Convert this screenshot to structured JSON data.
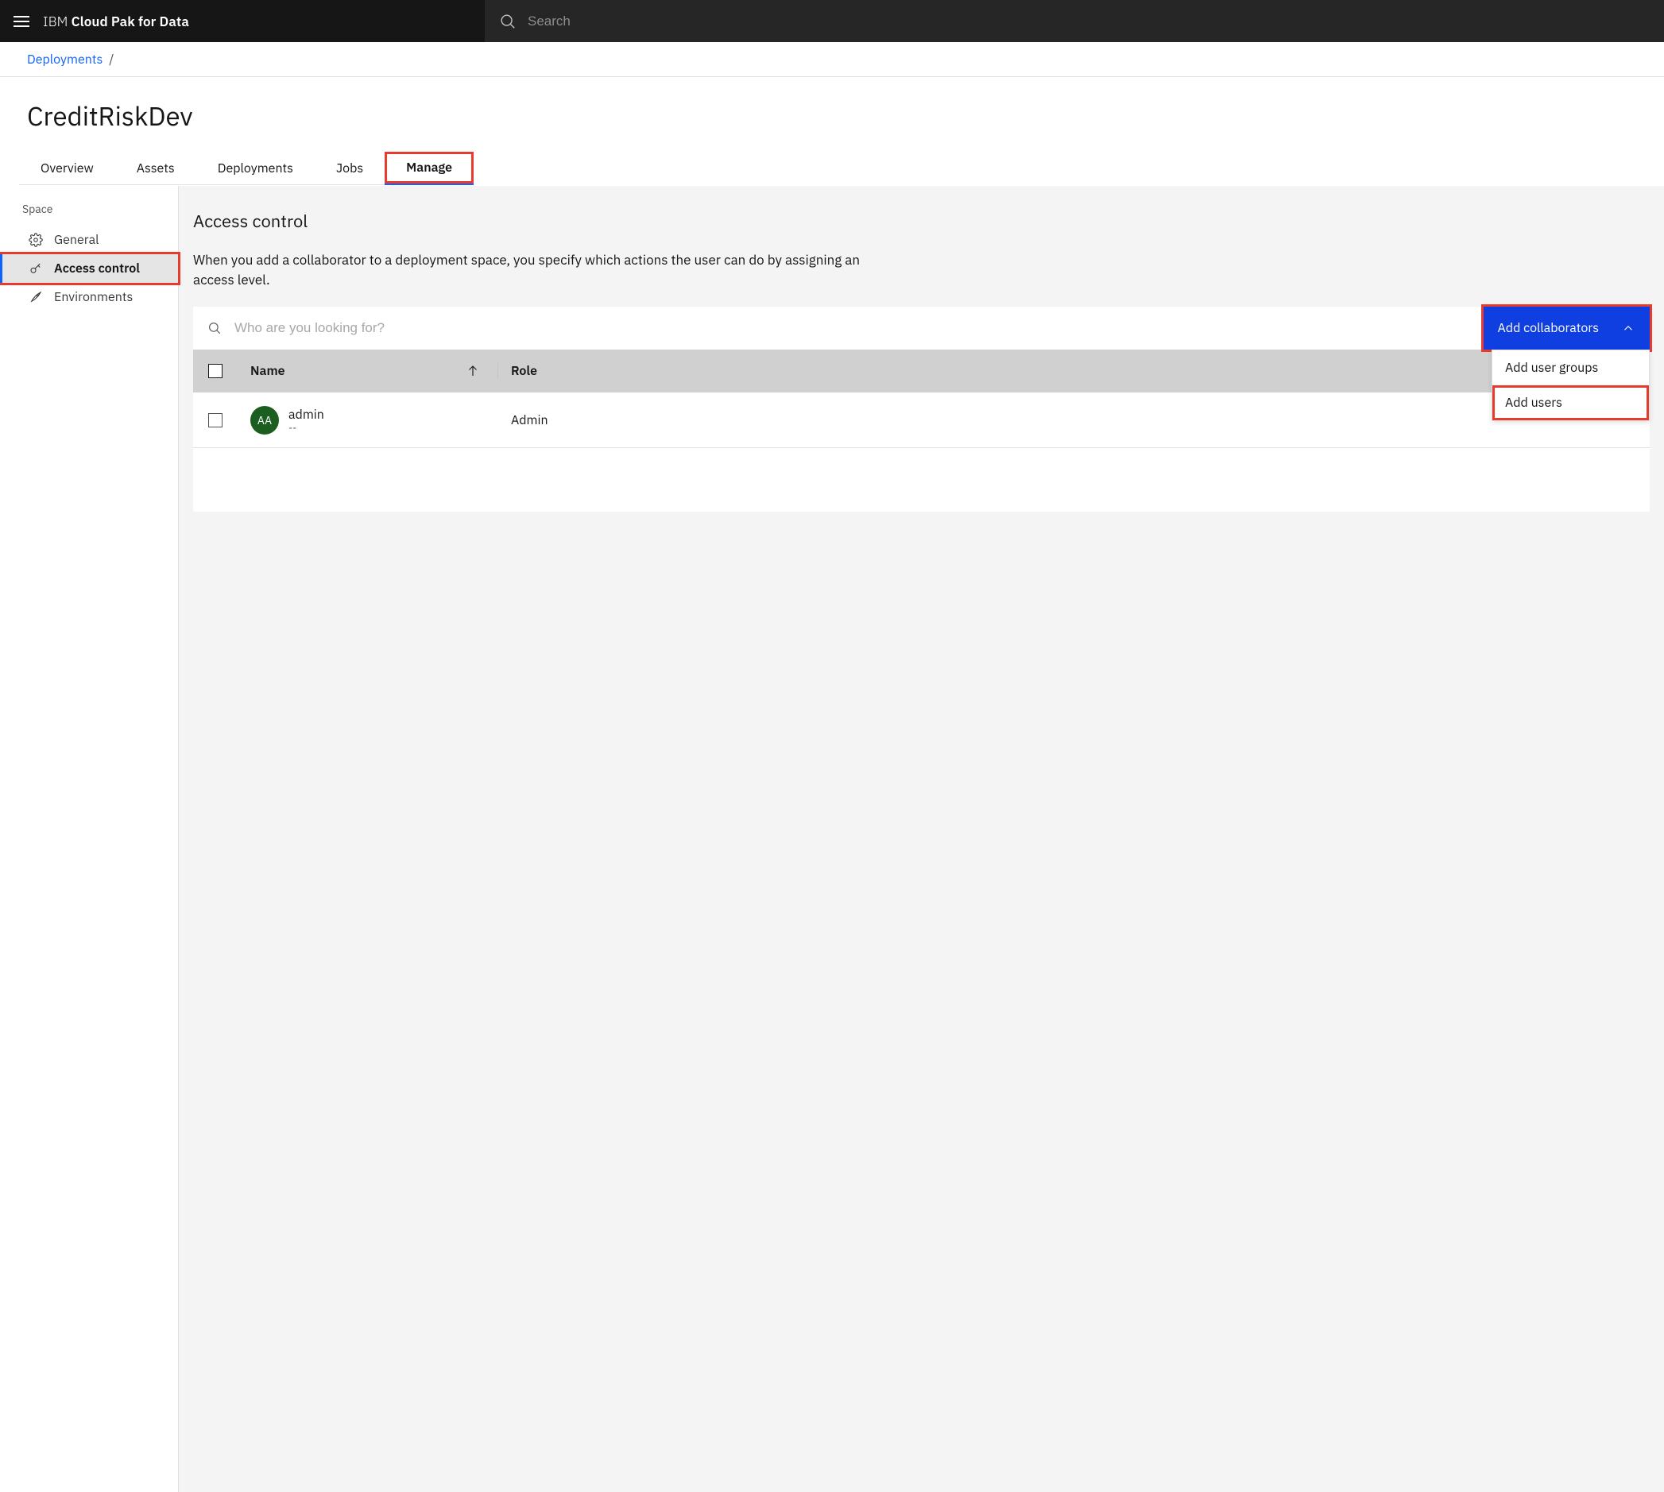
{
  "shell": {
    "brand_light": "IBM ",
    "brand_bold": "Cloud Pak for Data",
    "search_placeholder": "Search"
  },
  "breadcrumb": {
    "items": [
      {
        "label": "Deployments"
      }
    ]
  },
  "page_title": "CreditRiskDev",
  "tabs": [
    {
      "label": "Overview"
    },
    {
      "label": "Assets"
    },
    {
      "label": "Deployments"
    },
    {
      "label": "Jobs"
    },
    {
      "label": "Manage",
      "active": true,
      "highlight": true
    }
  ],
  "side_nav": {
    "group_label": "Space",
    "items": [
      {
        "label": "General",
        "icon": "gear"
      },
      {
        "label": "Access control",
        "icon": "key",
        "active": true,
        "highlight": true
      },
      {
        "label": "Environments",
        "icon": "rocket"
      }
    ]
  },
  "panel": {
    "title": "Access control",
    "description": "When you add a collaborator to a deployment space, you specify which actions the user can do by assigning an access level.",
    "search_placeholder": "Who are you looking for?",
    "add_button_label": "Add collaborators",
    "dropdown": [
      {
        "label": "Add user groups"
      },
      {
        "label": "Add users",
        "highlight": true
      }
    ],
    "table": {
      "columns": {
        "name": "Name",
        "role": "Role"
      },
      "rows": [
        {
          "avatar": "AA",
          "name": "admin",
          "detail": "--",
          "role": "Admin"
        }
      ]
    }
  }
}
